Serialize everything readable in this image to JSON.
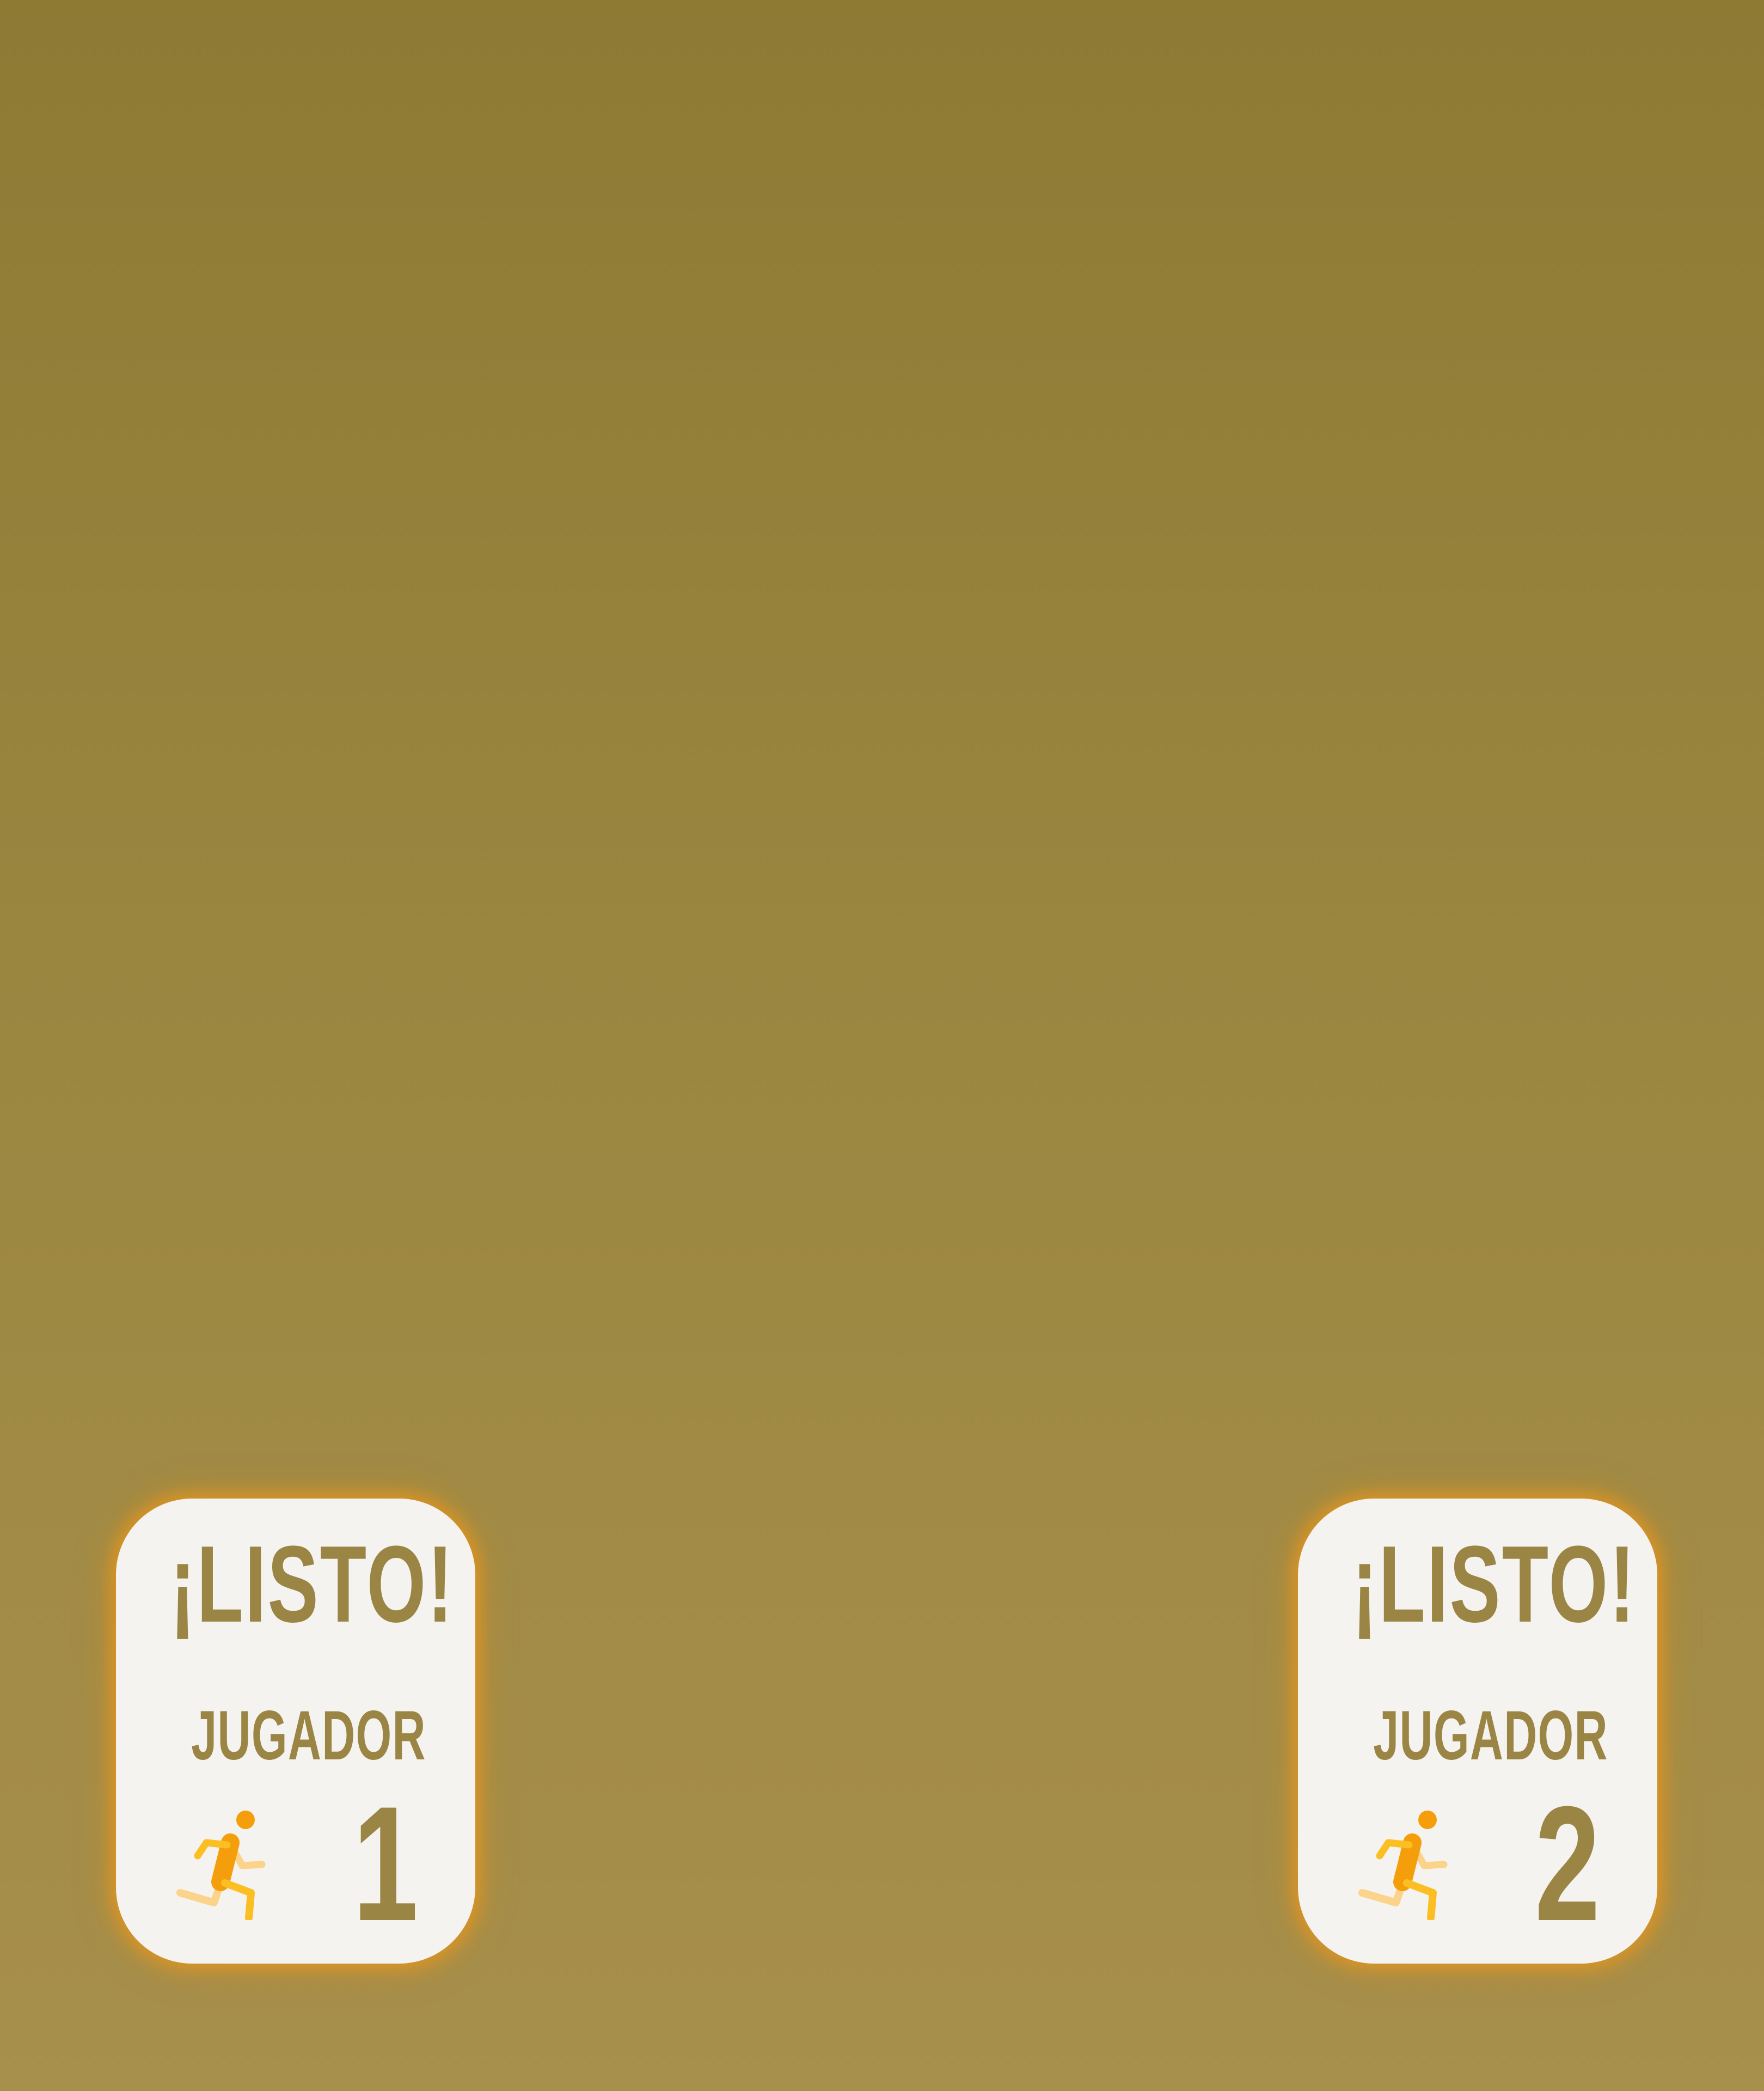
{
  "players": [
    {
      "status": "¡LISTO!",
      "label": "JUGADOR",
      "number": "1",
      "icon": "runner-icon"
    },
    {
      "status": "¡LISTO!",
      "label": "JUGADOR",
      "number": "2",
      "icon": "runner-icon"
    }
  ],
  "colors": {
    "background_top": "#8e7a33",
    "background_bottom": "#a78f4c",
    "card": "#f5f3ef",
    "text": "#9b8545",
    "glow": "#e8961c",
    "runner_primary": "#f59e0b",
    "runner_secondary": "#fbbf24",
    "runner_light": "#fcd38a"
  }
}
